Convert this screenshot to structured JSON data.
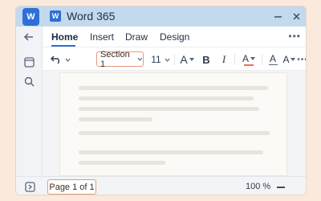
{
  "app": {
    "logo_letter": "W",
    "title": "Word 365",
    "title_icon_letter": "W",
    "accent_color": "#2f6fd6"
  },
  "window_controls": {
    "minimize_icon": "minus",
    "close_icon": "close"
  },
  "sidebar": {
    "items": [
      {
        "icon": "back-arrow-icon"
      },
      {
        "icon": "layout-icon"
      },
      {
        "icon": "search-icon"
      }
    ]
  },
  "menubar": {
    "tabs": [
      {
        "label": "Home",
        "active": true
      },
      {
        "label": "Insert",
        "active": false
      },
      {
        "label": "Draw",
        "active": false
      },
      {
        "label": "Design",
        "active": false
      }
    ],
    "more_label": "•••"
  },
  "toolbar": {
    "undo_icon": "undo-icon",
    "style_value": "Section 1",
    "font_size_value": "11",
    "font_grow_label": "A",
    "bold_label": "B",
    "italic_label": "I",
    "font_color_label": "A",
    "font_color": "#e8734f",
    "highlight_label": "A",
    "clear_format_label": "A",
    "more_label": "•••"
  },
  "document": {
    "line_count": 7
  },
  "statusbar": {
    "page_indicator": "Page 1 of 1",
    "zoom_level": "100 %",
    "layout_icon": "page-layout-icon"
  }
}
